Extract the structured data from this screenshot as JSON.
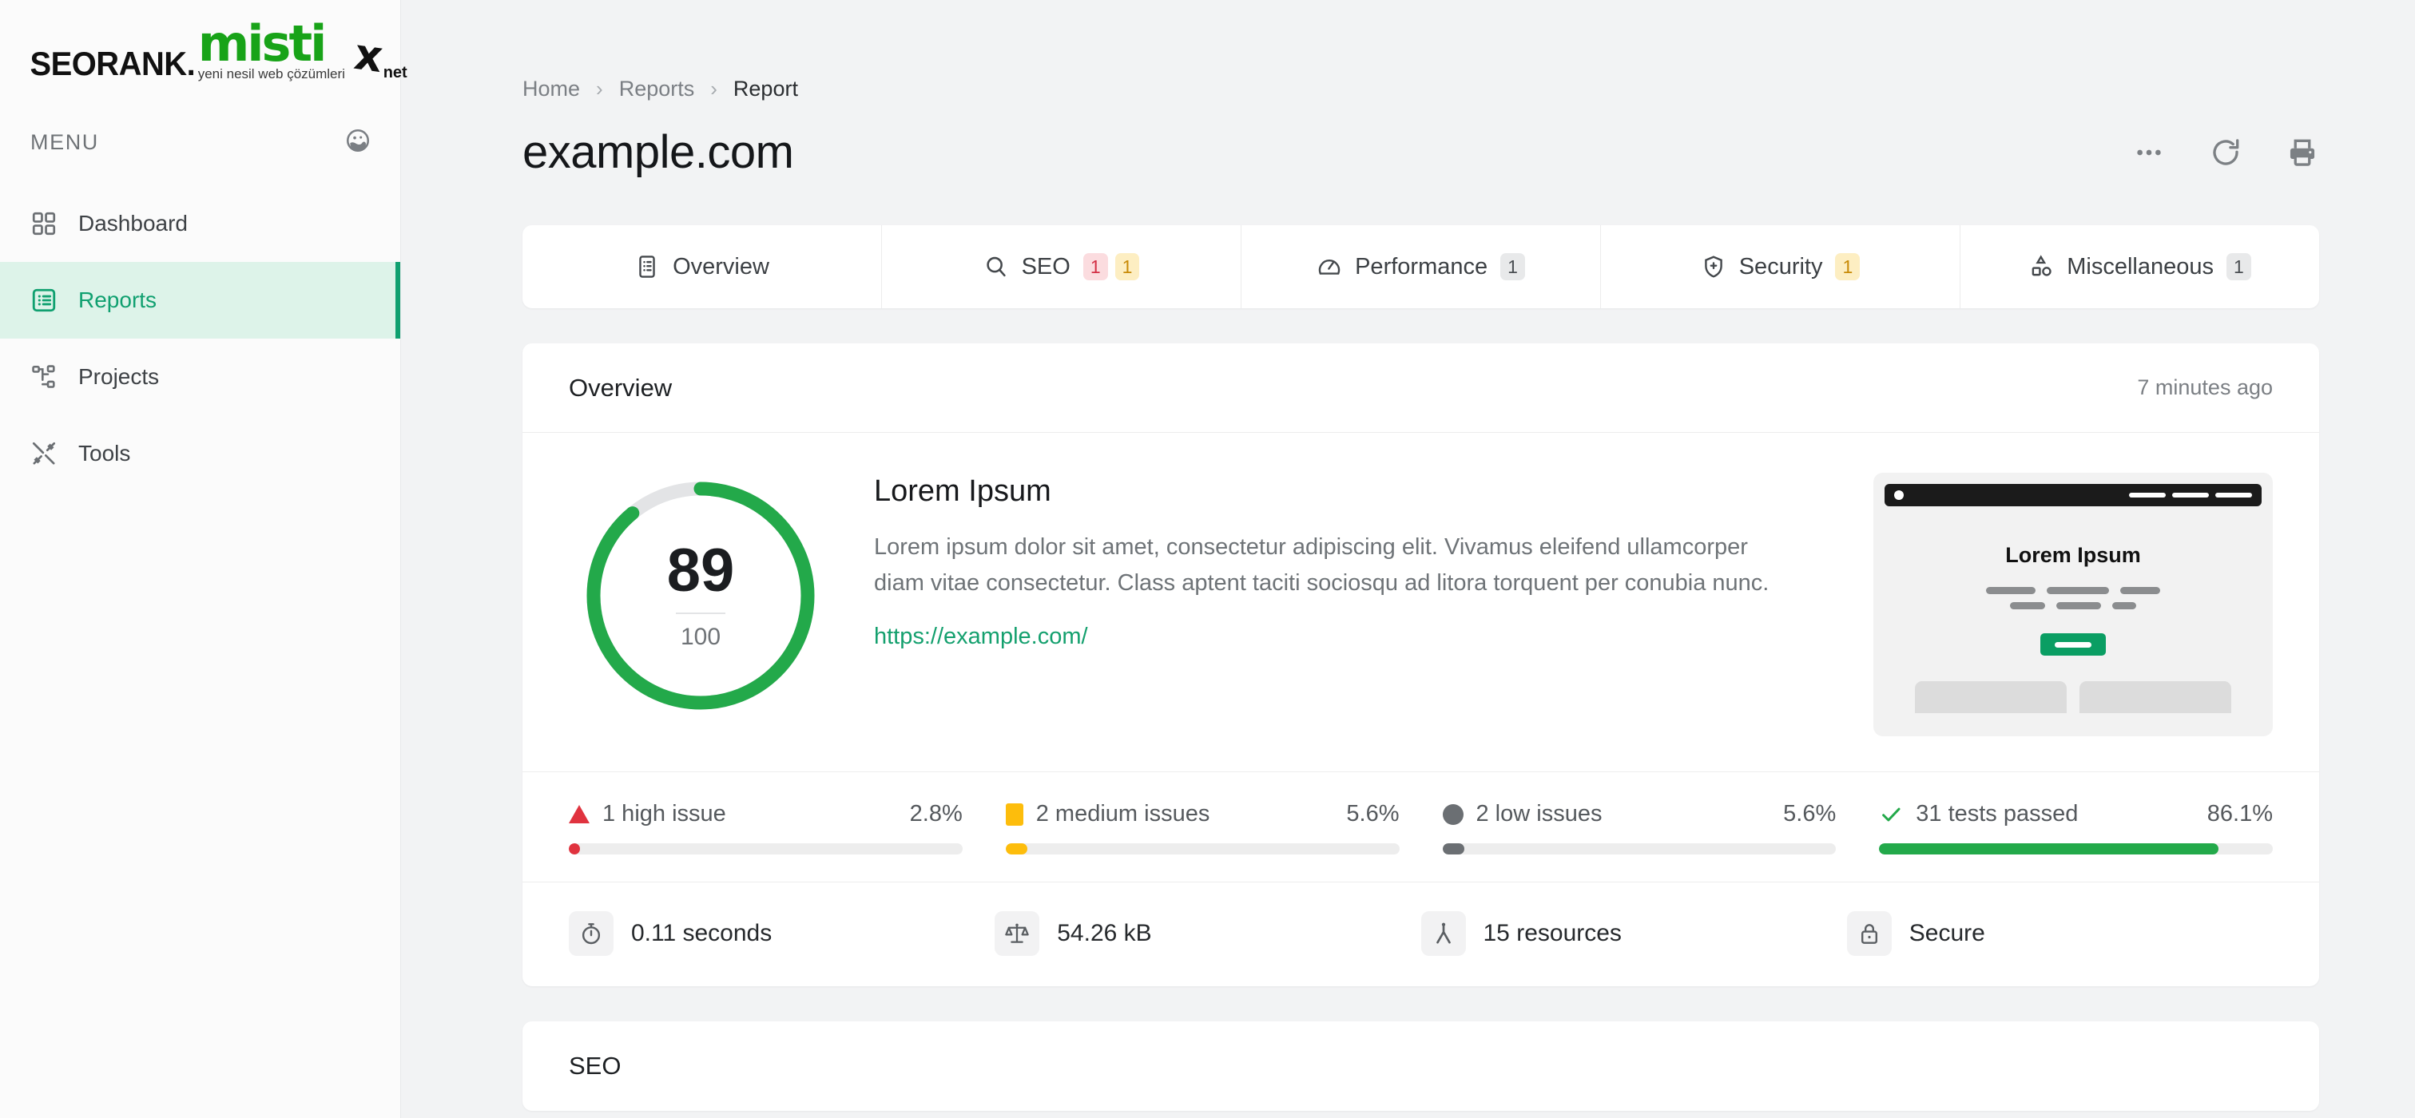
{
  "brand": {
    "name_dark": "SEORANK.",
    "name_green": "misti",
    "x_mark": "x",
    "tld": "net",
    "tagline": "yeni nesil web çözümleri"
  },
  "sidebar": {
    "menu_label": "MENU",
    "avatar_icon": "face-circle-icon",
    "items": [
      {
        "label": "Dashboard",
        "icon": "grid-icon",
        "active": false
      },
      {
        "label": "Reports",
        "icon": "list-box-icon",
        "active": true
      },
      {
        "label": "Projects",
        "icon": "sitemap-icon",
        "active": false
      },
      {
        "label": "Tools",
        "icon": "tools-icon",
        "active": false
      }
    ]
  },
  "breadcrumb": [
    {
      "label": "Home",
      "current": false
    },
    {
      "label": "Reports",
      "current": false
    },
    {
      "label": "Report",
      "current": true
    }
  ],
  "header": {
    "title": "example.com",
    "actions": [
      {
        "icon": "more-horizontal-icon",
        "name": "more-options-button"
      },
      {
        "icon": "refresh-icon",
        "name": "refresh-button"
      },
      {
        "icon": "print-icon",
        "name": "print-button"
      }
    ]
  },
  "tabs": [
    {
      "label": "Overview",
      "icon": "report-doc-icon",
      "badges": []
    },
    {
      "label": "SEO",
      "icon": "search-icon",
      "badges": [
        {
          "value": "1",
          "tone": "red"
        },
        {
          "value": "1",
          "tone": "amber"
        }
      ]
    },
    {
      "label": "Performance",
      "icon": "speedometer-icon",
      "badges": [
        {
          "value": "1",
          "tone": "grey"
        }
      ]
    },
    {
      "label": "Security",
      "icon": "shield-plus-icon",
      "badges": [
        {
          "value": "1",
          "tone": "amber"
        }
      ]
    },
    {
      "label": "Miscellaneous",
      "icon": "shapes-icon",
      "badges": [
        {
          "value": "1",
          "tone": "grey"
        }
      ]
    }
  ],
  "overview": {
    "section_title": "Overview",
    "timestamp": "7 minutes ago",
    "score": "89",
    "score_total": "100",
    "score_percent": 89,
    "heading": "Lorem Ipsum",
    "description": "Lorem ipsum dolor sit amet, consectetur adipiscing elit. Vivamus eleifend ullamcorper diam vitae consectetur. Class aptent taciti sociosqu ad litora torquent per conubia nunc.",
    "link": "https://example.com/",
    "thumbnail": {
      "title": "Lorem Ipsum"
    },
    "issues": [
      {
        "label": "1 high issue",
        "percent": "2.8%",
        "fill": 2.8,
        "marker": "triangle-warning-icon",
        "color": "#e0333f"
      },
      {
        "label": "2 medium issues",
        "percent": "5.6%",
        "fill": 5.6,
        "marker": "square-medium-icon",
        "color": "#fdbd0c"
      },
      {
        "label": "2 low issues",
        "percent": "5.6%",
        "fill": 5.6,
        "marker": "circle-low-icon",
        "color": "#6b6f73"
      },
      {
        "label": "31 tests passed",
        "percent": "86.1%",
        "fill": 86.1,
        "marker": "check-icon",
        "color": "#23a94a"
      }
    ],
    "metrics": [
      {
        "label": "0.11 seconds",
        "icon": "stopwatch-icon"
      },
      {
        "label": "54.26 kB",
        "icon": "scales-icon"
      },
      {
        "label": "15 resources",
        "icon": "resources-icon"
      },
      {
        "label": "Secure",
        "icon": "lock-icon"
      }
    ]
  },
  "seo_section": {
    "title": "SEO"
  },
  "colors": {
    "accent_green": "#10a070",
    "accent_green_soft": "#ddf3e9",
    "logo_green": "#18a318",
    "high": "#e0333f",
    "medium": "#fdbd0c",
    "low": "#6b6f73",
    "passed": "#23a94a",
    "page_bg": "#f2f3f4"
  }
}
